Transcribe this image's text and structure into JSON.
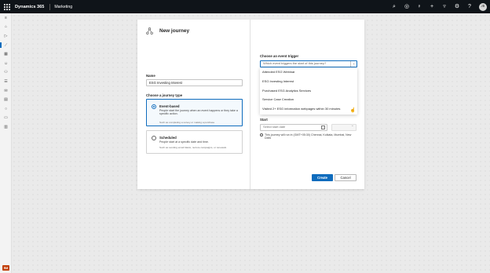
{
  "header": {
    "app_name": "Dynamics 365",
    "area_name": "Marketing",
    "user_initials": "JB"
  },
  "rail": {
    "area_badge": "RM"
  },
  "dialog": {
    "title": "New journey",
    "name_label": "Name",
    "name_value": "ESG Investing Interest",
    "journey_type_label": "Choose a journey type",
    "options": [
      {
        "title": "Event-based",
        "description": "People start the journey when an event happens or they take a specific action.",
        "example": "Such as completing a survey or making a purchase",
        "selected": true
      },
      {
        "title": "Scheduled",
        "description": "People start at a specific date and time.",
        "example": "Such as sending email blasts, nurture campaigns, or renewals",
        "selected": false
      }
    ],
    "trigger_label": "Choose an event trigger",
    "trigger_placeholder": "Which event triggers the start of this journey?",
    "trigger_options": [
      "Attended ESG Webinar",
      "ESG Investing Interest",
      "Purchased ESG Analytics Services",
      "Service Case Creation",
      "Visited 2+ ESG information webpages within 30 minutes"
    ],
    "start_label": "Start",
    "start_placeholder": "Select start date",
    "timezone_note": "This journey will run in (GMT+05:30) Chennai, Kolkata, Mumbai, New Delhi",
    "create_label": "Create",
    "cancel_label": "Cancel"
  },
  "colors": {
    "topbar": "#0f1419",
    "accent": "#0f6cbd",
    "area_badge": "#c2410c"
  }
}
